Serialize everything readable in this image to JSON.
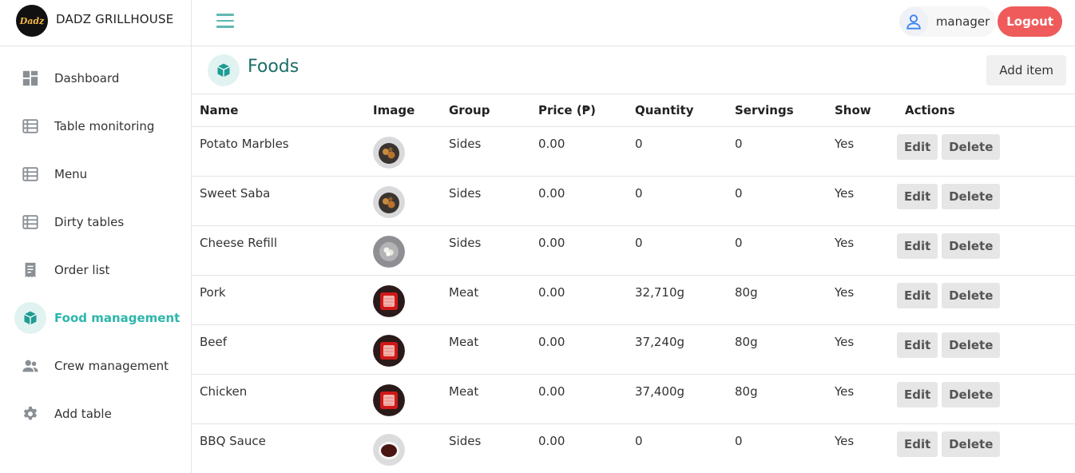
{
  "brand": {
    "name": "DADZ GRILLHOUSE",
    "logo_text": "Dadz"
  },
  "sidebar": {
    "items": [
      {
        "label": "Dashboard",
        "icon": "dashboard-icon"
      },
      {
        "label": "Table monitoring",
        "icon": "list-icon"
      },
      {
        "label": "Menu",
        "icon": "list-icon"
      },
      {
        "label": "Dirty tables",
        "icon": "list-icon"
      },
      {
        "label": "Order list",
        "icon": "receipt-icon"
      },
      {
        "label": "Food management",
        "icon": "cube-icon",
        "active": true
      },
      {
        "label": "Crew management",
        "icon": "people-icon"
      },
      {
        "label": "Add table",
        "icon": "gear-icon"
      }
    ]
  },
  "header": {
    "username": "manager",
    "logout_label": "Logout"
  },
  "page": {
    "title": "Foods",
    "add_label": "Add item"
  },
  "table": {
    "columns": [
      "Name",
      "Image",
      "Group",
      "Price (₱)",
      "Quantity",
      "Servings",
      "Show",
      "Actions"
    ],
    "edit_label": "Edit",
    "delete_label": "Delete",
    "rows": [
      {
        "name": "Potato Marbles",
        "group": "Sides",
        "price": "0.00",
        "quantity": "0",
        "servings": "0",
        "show": "Yes",
        "thumb": "bowl-dark"
      },
      {
        "name": "Sweet Saba",
        "group": "Sides",
        "price": "0.00",
        "quantity": "0",
        "servings": "0",
        "show": "Yes",
        "thumb": "bowl-dark"
      },
      {
        "name": "Cheese Refill",
        "group": "Sides",
        "price": "0.00",
        "quantity": "0",
        "servings": "0",
        "show": "Yes",
        "thumb": "bowl-grey"
      },
      {
        "name": "Pork",
        "group": "Meat",
        "price": "0.00",
        "quantity": "32,710g",
        "servings": "80g",
        "show": "Yes",
        "thumb": "tray-red"
      },
      {
        "name": "Beef",
        "group": "Meat",
        "price": "0.00",
        "quantity": "37,240g",
        "servings": "80g",
        "show": "Yes",
        "thumb": "tray-red"
      },
      {
        "name": "Chicken",
        "group": "Meat",
        "price": "0.00",
        "quantity": "37,400g",
        "servings": "80g",
        "show": "Yes",
        "thumb": "tray-red"
      },
      {
        "name": "BBQ Sauce",
        "group": "Sides",
        "price": "0.00",
        "quantity": "0",
        "servings": "0",
        "show": "Yes",
        "thumb": "bowl-sauce"
      }
    ]
  },
  "colors": {
    "accent": "#2cb6ac",
    "logout": "#ef5b5b",
    "title": "#1c6e69"
  }
}
